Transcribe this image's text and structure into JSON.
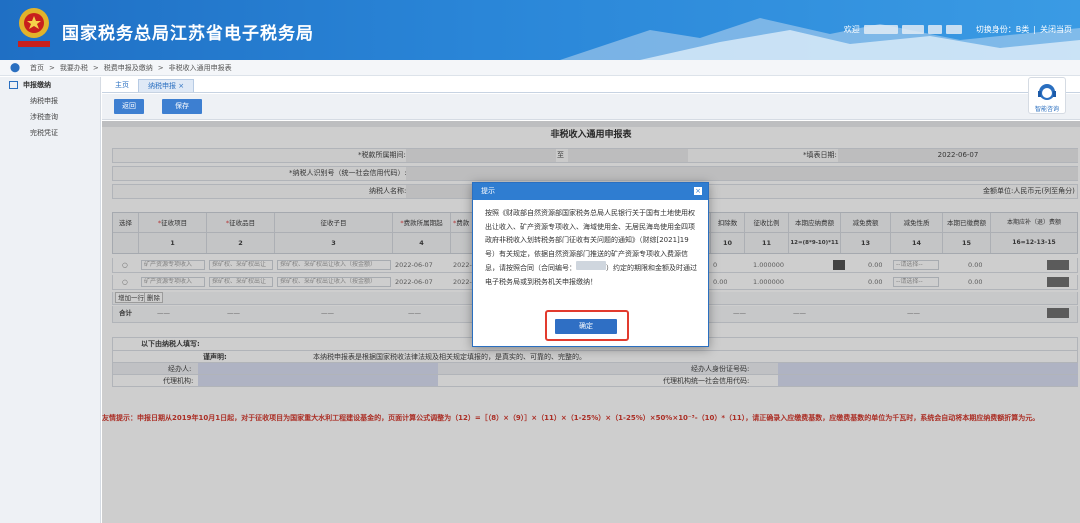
{
  "header": {
    "title": "国家税务总局江苏省电子税务局",
    "welcome": "欢迎",
    "switch_identity": "切换身份：B类",
    "close_page": "关闭当页"
  },
  "breadcrumb": [
    "首页",
    "我要办税",
    "税费申报及缴纳",
    "非税收入通用申报表"
  ],
  "sidebar": {
    "heading": "申报缴纳",
    "items": [
      "纳税申报",
      "涉税查询",
      "完税凭证"
    ]
  },
  "tabs": [
    {
      "label": "主页",
      "active": false
    },
    {
      "label": "纳税申报",
      "active": true,
      "close": "×"
    }
  ],
  "toolbar": {
    "back": "返回",
    "save": "保存"
  },
  "help": {
    "label": "智能咨询"
  },
  "form": {
    "title": "非税收入通用申报表",
    "period_label": "*税款所属期间:",
    "period_to": "至",
    "fill_date_label": "*填表日期:",
    "fill_date": "2022-06-07",
    "taxpayer_id_label": "*纳税人识别号（统一社会信用代码）:",
    "taxpayer_name_label": "纳税人名称:",
    "unit_label": "金额单位:人民币元(列至角分)"
  },
  "table": {
    "columns": [
      {
        "h": "选择",
        "n": "",
        "req": false
      },
      {
        "h": "征收项目",
        "n": "1",
        "req": true
      },
      {
        "h": "征收品目",
        "n": "2",
        "req": true
      },
      {
        "h": "征收子目",
        "n": "3",
        "req": false
      },
      {
        "h": "费款所属期起",
        "n": "4",
        "req": true
      },
      {
        "h": "费款",
        "n": "",
        "req": true
      },
      {
        "h": "扣除数",
        "n": "10",
        "req": false
      },
      {
        "h": "征收比例",
        "n": "11",
        "req": false
      },
      {
        "h": "本期应纳费额",
        "n": "12=(8*9-10)*11",
        "req": false
      },
      {
        "h": "减免费额",
        "n": "13",
        "req": false
      },
      {
        "h": "减免性质",
        "n": "14",
        "req": false
      },
      {
        "h": "本期已缴费额",
        "n": "15",
        "req": false
      },
      {
        "h": "本期应补（退）费额",
        "n": "16=12-13-15",
        "req": false
      }
    ],
    "rows": [
      {
        "item": "矿产资源专项收入",
        "sub_item": "探矿权、采矿权出让",
        "child": "探矿权、采矿权出让收入（按金额）",
        "start": "2022-06-07",
        "mid": "2022-0",
        "deduct": "0",
        "rate": "1.000000",
        "reduce": "0.00",
        "nature": "--请选择--",
        "paid": "0.00"
      },
      {
        "item": "矿产资源专项收入",
        "sub_item": "探矿权、采矿权出让",
        "child": "探矿权、采矿权出让收入（按金额）",
        "start": "2022-06-07",
        "mid": "2022-0",
        "deduct": "0.00",
        "rate": "1.000000",
        "reduce": "0.00",
        "nature": "--请选择--",
        "paid": "0.00"
      }
    ],
    "add_row": "增加一行",
    "delete_row": "删除",
    "total_label": "合计",
    "dash": "——"
  },
  "declaration": {
    "heading": "以下由纳税人填写:",
    "statement_label": "谨声明:",
    "statement": "本纳税申报表是根据国家税收法律法规及相关规定填报的，是真实的、可靠的、完整的。",
    "handler_label": "经办人:",
    "handler_id_label": "经办人身份证号码:",
    "agent_label": "代理机构:",
    "agent_code_label": "代理机构统一社会信用代码:"
  },
  "tip": "友情提示：申报日期从2019年10月1日起，对于征收项目为国家重大水利工程建设基金的，页面计算公式调整为（12）=［（8）×（9）］×（11）×（1-25%）×（1-25%）×50%×10⁻³-（10）*（11），请正确录入应缴费基数，应缴费基数的单位为千瓦时，系统会自动将本期应纳费额折算为元。",
  "modal": {
    "title": "提示",
    "close": "×",
    "message": "按照《财政部自然资源部国家税务总局人民银行关于国有土地使用权出让收入、矿产资源专项收入、海域使用金、无居民海岛使用金四项政府非税收入划转税务部门征收有关问题的通知》（财综[2021]19号）有关规定，依据自然资源部门推送的矿产资源专项收入费源信息，请按照合同（合同编号：",
    "message_tail": "）约定的期限和金额及时通过电子税务局或到税务机关申报缴纳！",
    "ok": "确定"
  },
  "colors": {
    "header_blue": "#2a86d8",
    "button_blue": "#3d7fd1",
    "highlight_red": "#e23b2e",
    "tip_red": "#d02a1e"
  }
}
